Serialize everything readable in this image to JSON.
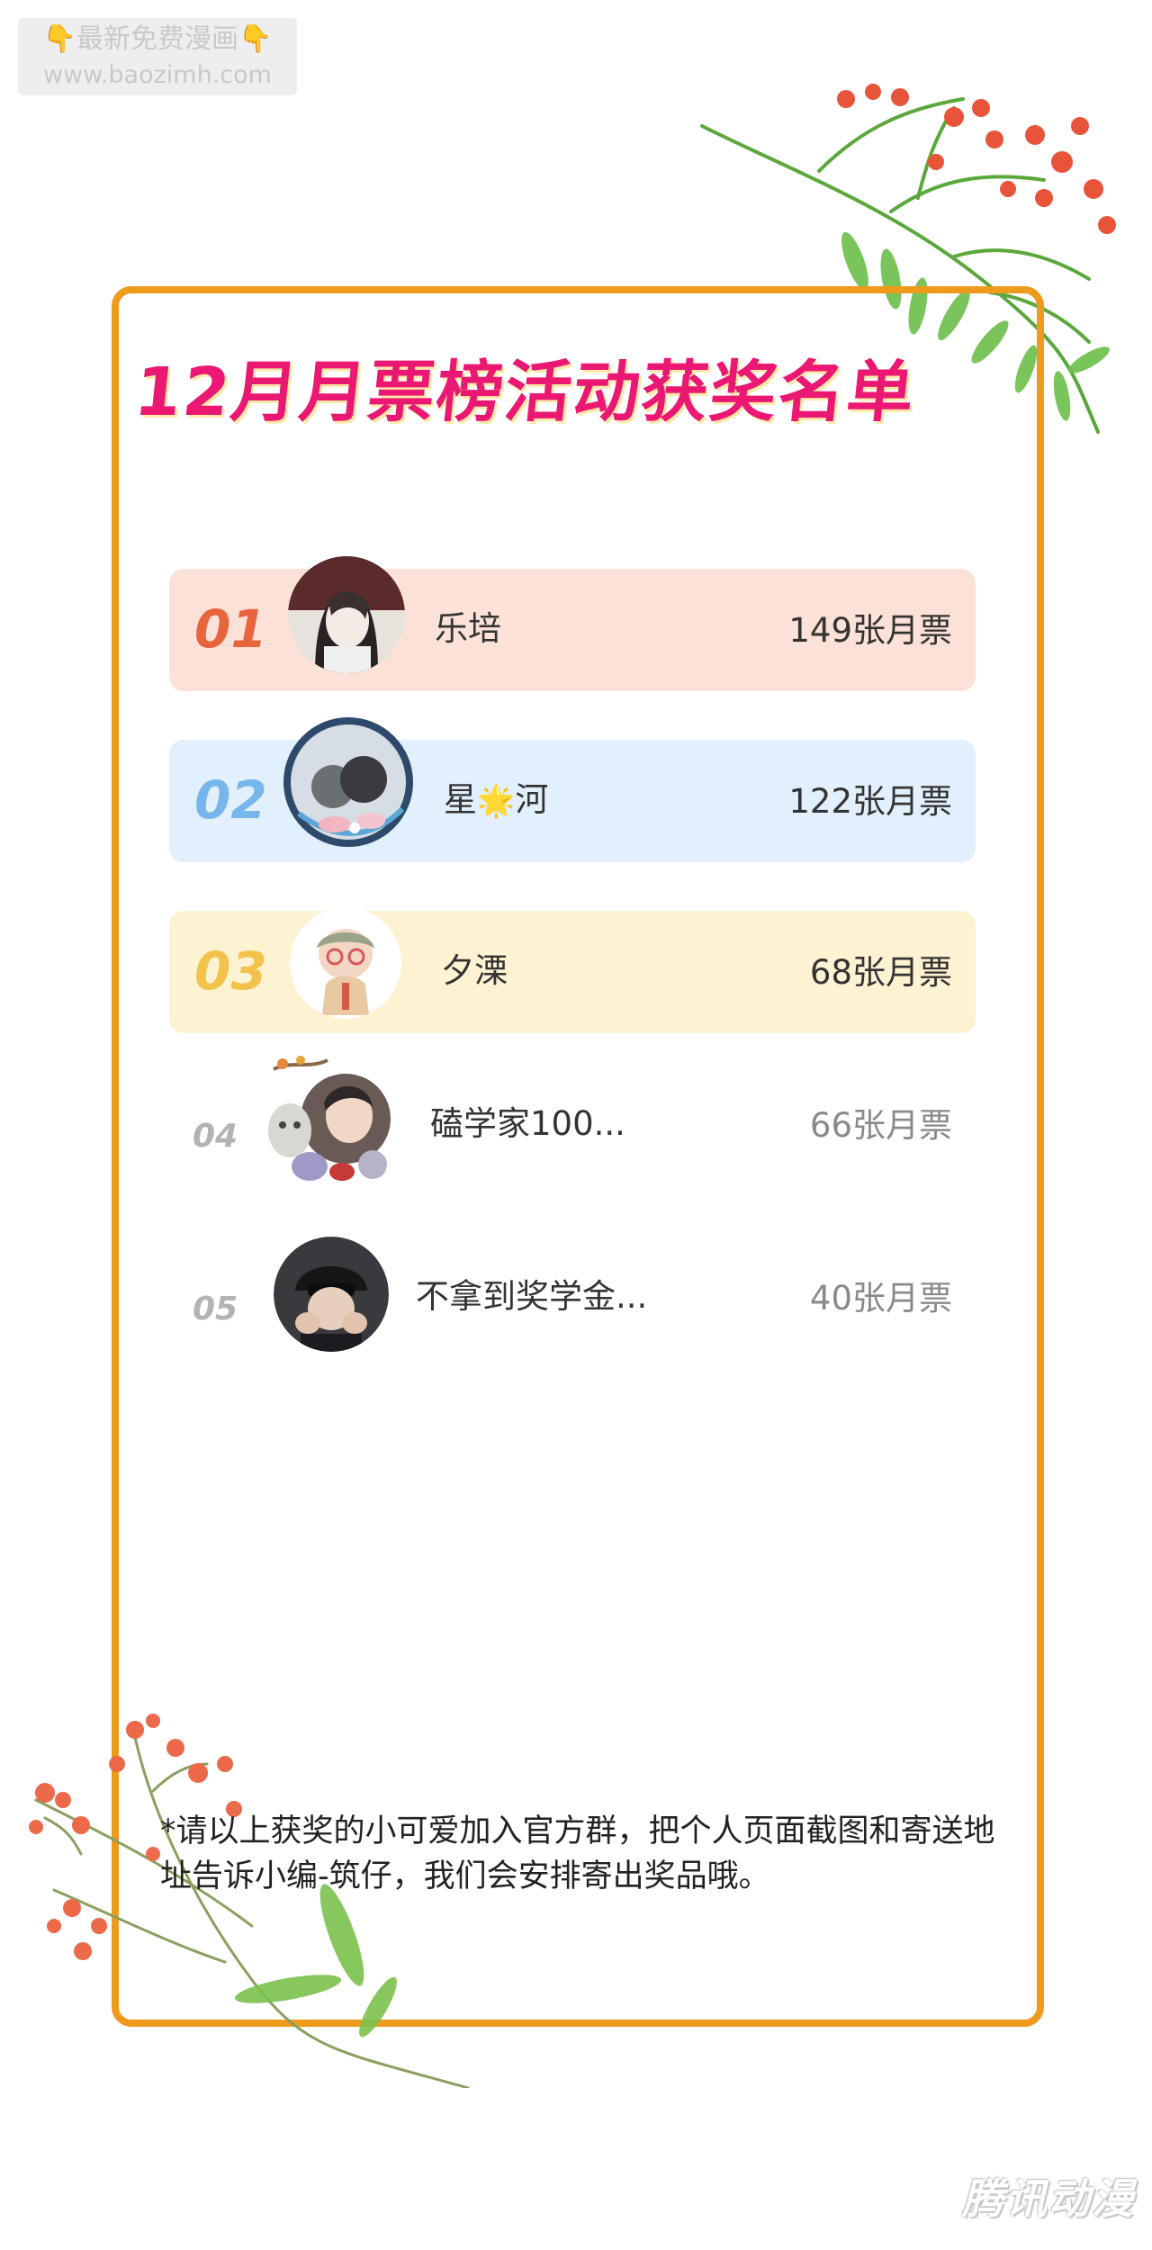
{
  "watermark_top": {
    "hand": "👇",
    "line1": "最新免费漫画",
    "url": "www.baozimh.com"
  },
  "title": "12月月票榜活动获奖名单",
  "rankings": [
    {
      "rank": "01",
      "name": "乐培",
      "votes": "149张月票",
      "bg": "#fbe1d7",
      "num_color": "#e8643c"
    },
    {
      "rank": "02",
      "name_a": "星",
      "star": "🌟",
      "name_b": "河",
      "votes": "122张月票",
      "bg": "#e2effc",
      "num_color": "#76b6ec"
    },
    {
      "rank": "03",
      "name": "夕溧",
      "votes": "68张月票",
      "bg": "#fdf2d2",
      "num_color": "#f3c24a"
    },
    {
      "rank": "04",
      "name": "磕学家100...",
      "votes": "66张月票"
    },
    {
      "rank": "05",
      "name": "不拿到奖学金...",
      "votes": "40张月票"
    }
  ],
  "footer_note": "*请以上获奖的小可爱加入官方群，把个人页面截图和寄送地址告诉小编-筑仔，我们会安排寄出奖品哦。",
  "watermark_bottom": "腾讯动漫"
}
